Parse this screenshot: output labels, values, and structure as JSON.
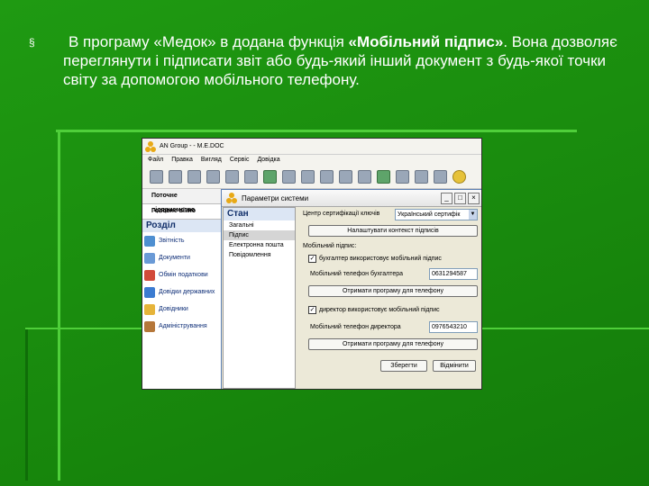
{
  "slide": {
    "bullet_symbol": "§",
    "text_part1": "В програму «Медок» в додана функція ",
    "text_bold": "«Мобільний підпис»",
    "text_part2": ". Вона дозволяє переглянути і підписати звіт або будь-який інший документ з будь-якої точки світу за допомогою мобільного телефону."
  },
  "app": {
    "title": "AN Group  -  - M.E.DOC",
    "menu": [
      "Файл",
      "Правка",
      "Вигляд",
      "Сервіс",
      "Довідка"
    ],
    "left_tabs": [
      "Поточне підприємство",
      "Головне вікно"
    ],
    "section_title": "Розділ",
    "nav_items": [
      {
        "label": "Звітність",
        "icon": "report-icon"
      },
      {
        "label": "Документи",
        "icon": "documents-icon"
      },
      {
        "label": "Обмін податкови",
        "icon": "exchange-icon"
      },
      {
        "label": "Довідки державних",
        "icon": "references-icon"
      },
      {
        "label": "Довідники",
        "icon": "catalogs-icon"
      },
      {
        "label": "Адміністрування",
        "icon": "admin-icon"
      }
    ]
  },
  "dialog": {
    "title": "Параметри системи",
    "state_title": "Стан",
    "state_items": [
      "Загальні",
      "Підпис",
      "Електронна пошта",
      "Повідомлення"
    ],
    "selected_state_item": "Підпис",
    "cert_center_label": "Центр сертифікації ключів",
    "cert_center_value": "Український сертифік",
    "configure_button": "Налаштувати контекст підписів",
    "mobile_sign_label": "Мобільний підпис:",
    "accountant_checkbox": "бухгалтер використовує мобільний підпис",
    "accountant_phone_label": "Мобільний телефон бухгалтера",
    "accountant_phone_value": "0631294587",
    "get_program_button_1": "Отримати програму для телефону",
    "director_checkbox": "директор використовує мобільний підпис",
    "director_phone_label": "Мобільний телефон директора",
    "director_phone_value": "0976543210",
    "get_program_button_2": "Отримати програму для телефону",
    "save_button": "Зберегти",
    "cancel_button": "Відмінити"
  }
}
